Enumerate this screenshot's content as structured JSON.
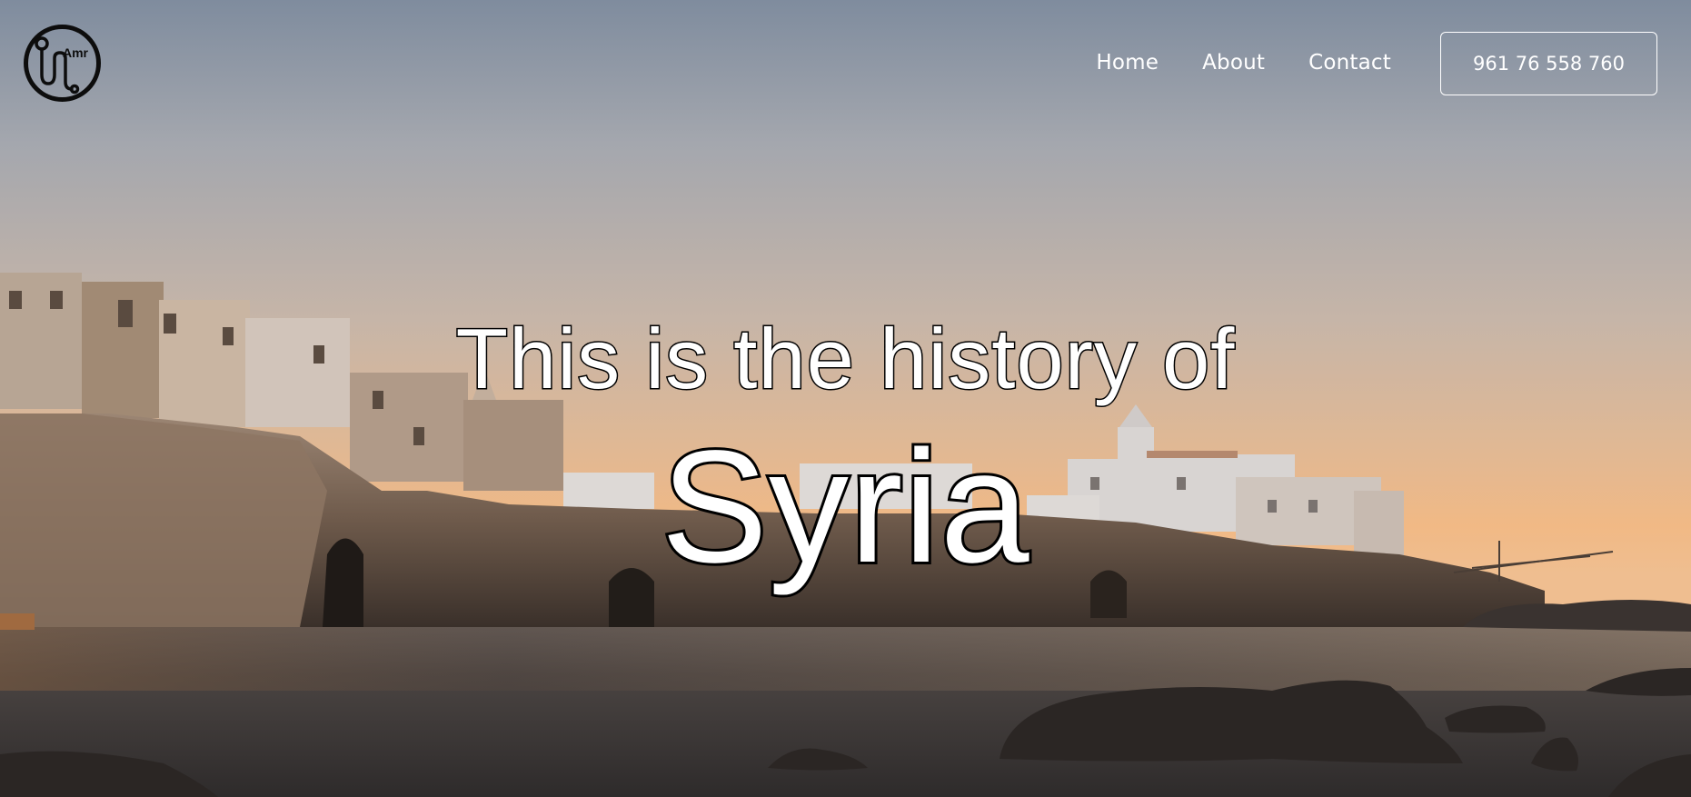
{
  "brand": {
    "logo_text": "Amr",
    "logo_icon": "stethoscope-icon"
  },
  "nav": {
    "items": [
      {
        "label": "Home"
      },
      {
        "label": "About"
      },
      {
        "label": "Contact"
      }
    ],
    "phone": "961 76 558 760"
  },
  "hero": {
    "subtitle": "This is the history of",
    "title": "Syria",
    "background": "coastal-town-sunset-photo"
  },
  "colors": {
    "text": "#ffffff",
    "outline": "#000000",
    "sky_top": "#7f8c9e",
    "sky_bottom": "#f1b985",
    "water": "#3a3633"
  }
}
